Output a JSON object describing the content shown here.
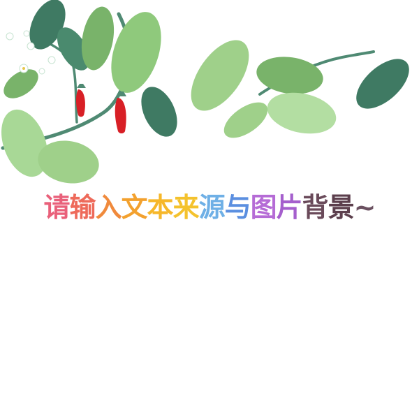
{
  "headline": {
    "chars": [
      {
        "text": "请",
        "color": "#e9607a"
      },
      {
        "text": "输",
        "color": "#ee6a5a"
      },
      {
        "text": "入",
        "color": "#f08a3c"
      },
      {
        "text": "文",
        "color": "#f3a12e"
      },
      {
        "text": "本",
        "color": "#f6b72a"
      },
      {
        "text": "来",
        "color": "#f4c22d"
      },
      {
        "text": "源",
        "color": "#6fb0e6"
      },
      {
        "text": "与",
        "color": "#5b8fe0"
      },
      {
        "text": "图",
        "color": "#b56bd6"
      },
      {
        "text": "片",
        "color": "#a55fcd"
      },
      {
        "text": "背",
        "color": "#6a4a5a"
      },
      {
        "text": "景",
        "color": "#5c3f4d"
      },
      {
        "text": "~",
        "color": "#6a5060"
      }
    ]
  },
  "palette": {
    "leaf_light": "#9fd08a",
    "leaf_mid": "#79b36a",
    "leaf_dark": "#3f7a63",
    "stem": "#4f8a73",
    "pepper_red": "#d81f26",
    "flower": "#ffffff"
  }
}
